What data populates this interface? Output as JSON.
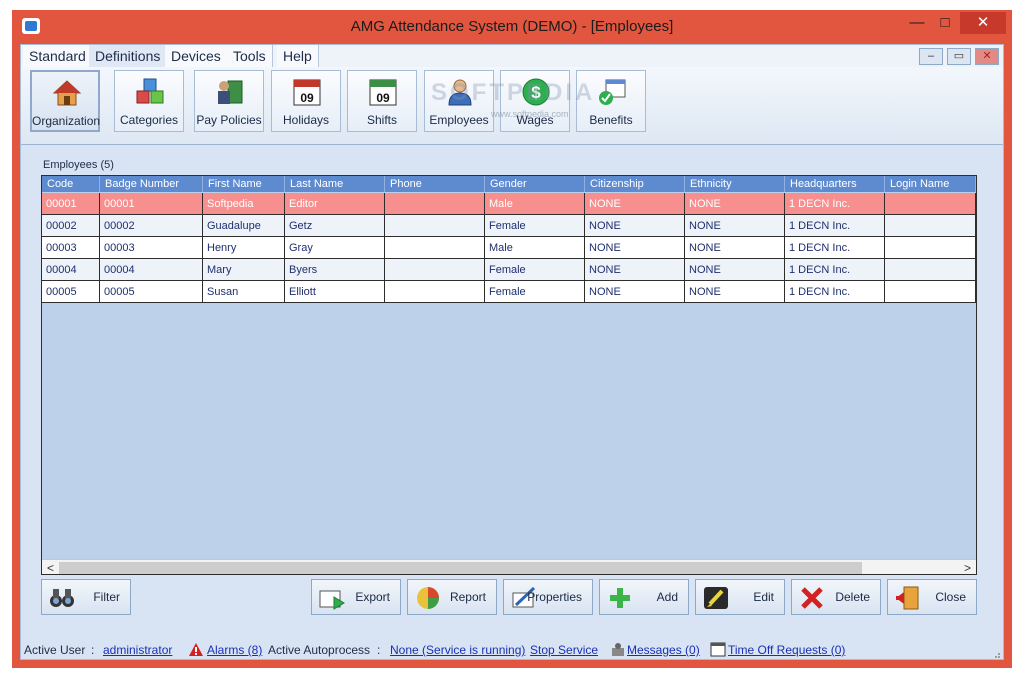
{
  "window": {
    "title": "AMG Attendance System (DEMO) - [Employees]",
    "controls": {
      "minimize": "—",
      "maximize": "□",
      "close": "✕"
    }
  },
  "menu": {
    "items": [
      "Standard",
      "Definitions",
      "Devices",
      "Tools",
      "Help"
    ],
    "mdi_controls": {
      "minimize": "–",
      "restore": "▭",
      "close": "✕"
    }
  },
  "ribbon": {
    "buttons": [
      {
        "label": "Organization",
        "icon": "house-icon"
      },
      {
        "label": "Categories",
        "icon": "cubes-icon"
      },
      {
        "label": "Pay Policies",
        "icon": "policy-book-icon"
      },
      {
        "label": "Holidays",
        "icon": "calendar-icon",
        "day": "09"
      },
      {
        "label": "Shifts",
        "icon": "calendar-icon",
        "day": "09"
      },
      {
        "label": "Employees",
        "icon": "person-icon"
      },
      {
        "label": "Wages",
        "icon": "dollar-icon"
      },
      {
        "label": "Benefits",
        "icon": "benefits-check-icon"
      }
    ],
    "watermark": "SOFTPEDIA",
    "watermark_sub": "www.softpedia.com"
  },
  "main": {
    "section_label": "Employees (5)",
    "columns": [
      "Code",
      "Badge Number",
      "First Name",
      "Last Name",
      "Phone",
      "Gender",
      "Citizenship",
      "Ethnicity",
      "Headquarters",
      "Login Name"
    ],
    "rows": [
      [
        "00001",
        "00001",
        "Softpedia",
        "Editor",
        "",
        "Male",
        "NONE",
        "NONE",
        "1   DECN Inc.",
        ""
      ],
      [
        "00002",
        "00002",
        "Guadalupe",
        "Getz",
        "",
        "Female",
        "NONE",
        "NONE",
        "1   DECN Inc.",
        ""
      ],
      [
        "00003",
        "00003",
        "Henry",
        "Gray",
        "",
        "Male",
        "NONE",
        "NONE",
        "1   DECN Inc.",
        ""
      ],
      [
        "00004",
        "00004",
        "Mary",
        "Byers",
        "",
        "Female",
        "NONE",
        "NONE",
        "1   DECN Inc.",
        ""
      ],
      [
        "00005",
        "00005",
        "Susan",
        "Elliott",
        "",
        "Female",
        "NONE",
        "NONE",
        "1   DECN Inc.",
        ""
      ]
    ],
    "selected_row": 0,
    "scroll_left": "<",
    "scroll_right": ">"
  },
  "actions": {
    "filter": "Filter",
    "export": "Export",
    "report": "Report",
    "properties": "Properties",
    "add": "Add",
    "edit": "Edit",
    "delete": "Delete",
    "close": "Close"
  },
  "status": {
    "active_user_label": "Active User",
    "sep": ":",
    "active_user": "administrator",
    "alarms": "Alarms (8)",
    "autoprocess_label": "Active Autoprocess",
    "autoprocess_value": "None (Service is running)",
    "stop_service": "Stop Service",
    "messages": "Messages (0)",
    "time_off": "Time Off Requests (0)"
  },
  "colors": {
    "frame": "#e2563f",
    "header": "#5e8bd0",
    "selected_row": "#f78f8f",
    "grid_bg": "#bed1ea"
  }
}
